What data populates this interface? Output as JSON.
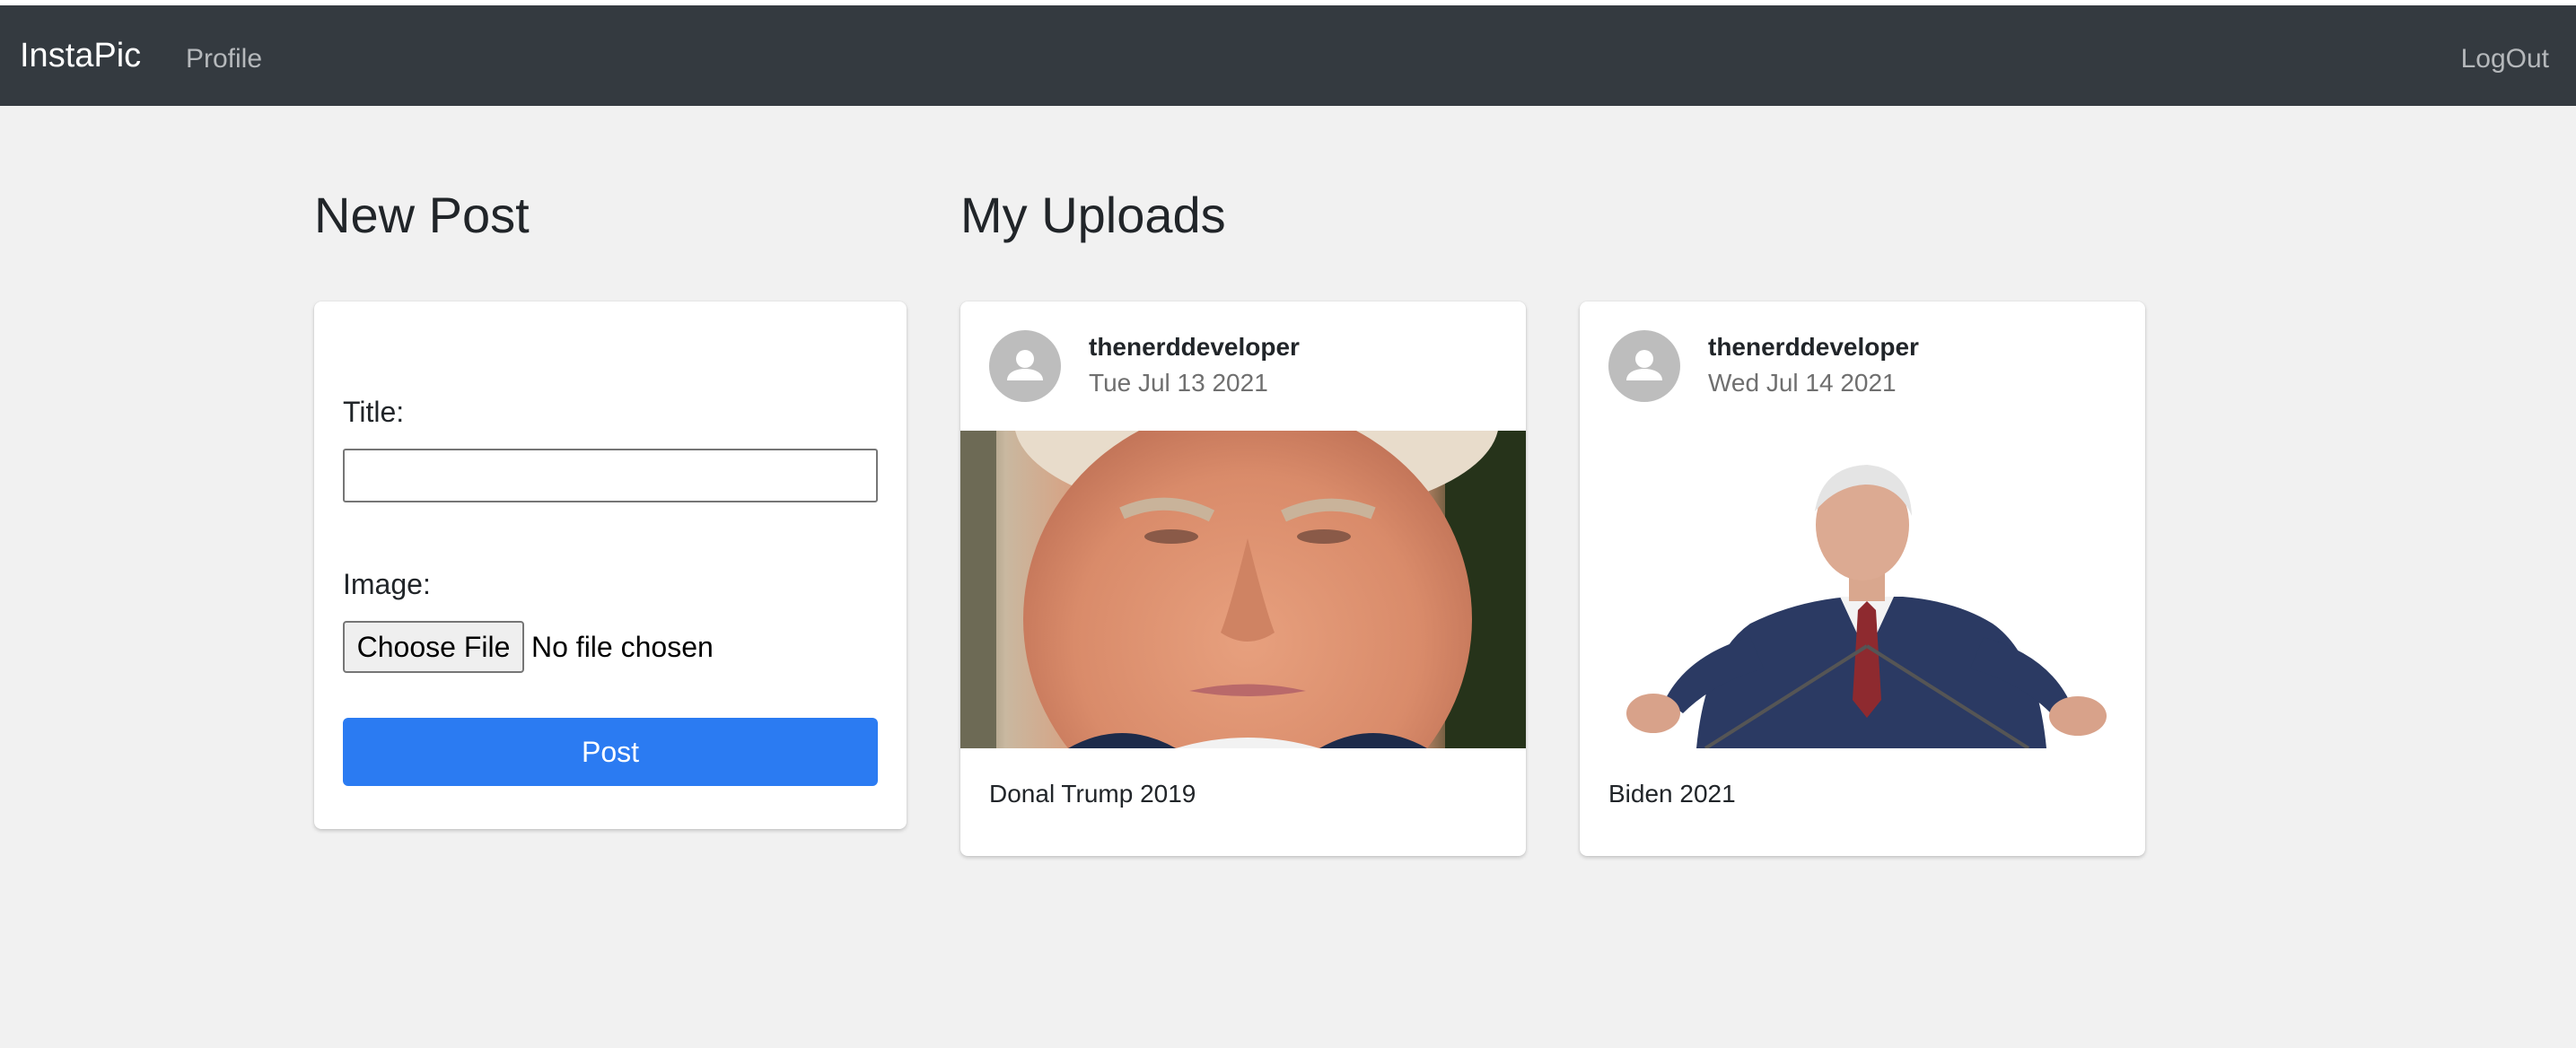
{
  "navbar": {
    "brand": "InstaPic",
    "profile_link": "Profile",
    "logout_link": "LogOut"
  },
  "new_post": {
    "heading": "New Post",
    "title_label": "Title:",
    "title_value": "",
    "image_label": "Image:",
    "choose_file_label": "Choose File",
    "file_status": "No file chosen",
    "post_button": "Post"
  },
  "uploads": {
    "heading": "My Uploads",
    "posts": [
      {
        "username": "thenerddeveloper",
        "date": "Tue Jul 13 2021",
        "caption": "Donal Trump 2019",
        "image": "portrait-closeup-photo"
      },
      {
        "username": "thenerddeveloper",
        "date": "Wed Jul 14 2021",
        "caption": "Biden 2021",
        "image": "speaker-at-podium-photo"
      }
    ]
  },
  "colors": {
    "navbar_bg": "#343a40",
    "page_bg": "#f1f1f1",
    "primary_button": "#2b7bf2",
    "avatar_bg": "#bdbdbd"
  }
}
